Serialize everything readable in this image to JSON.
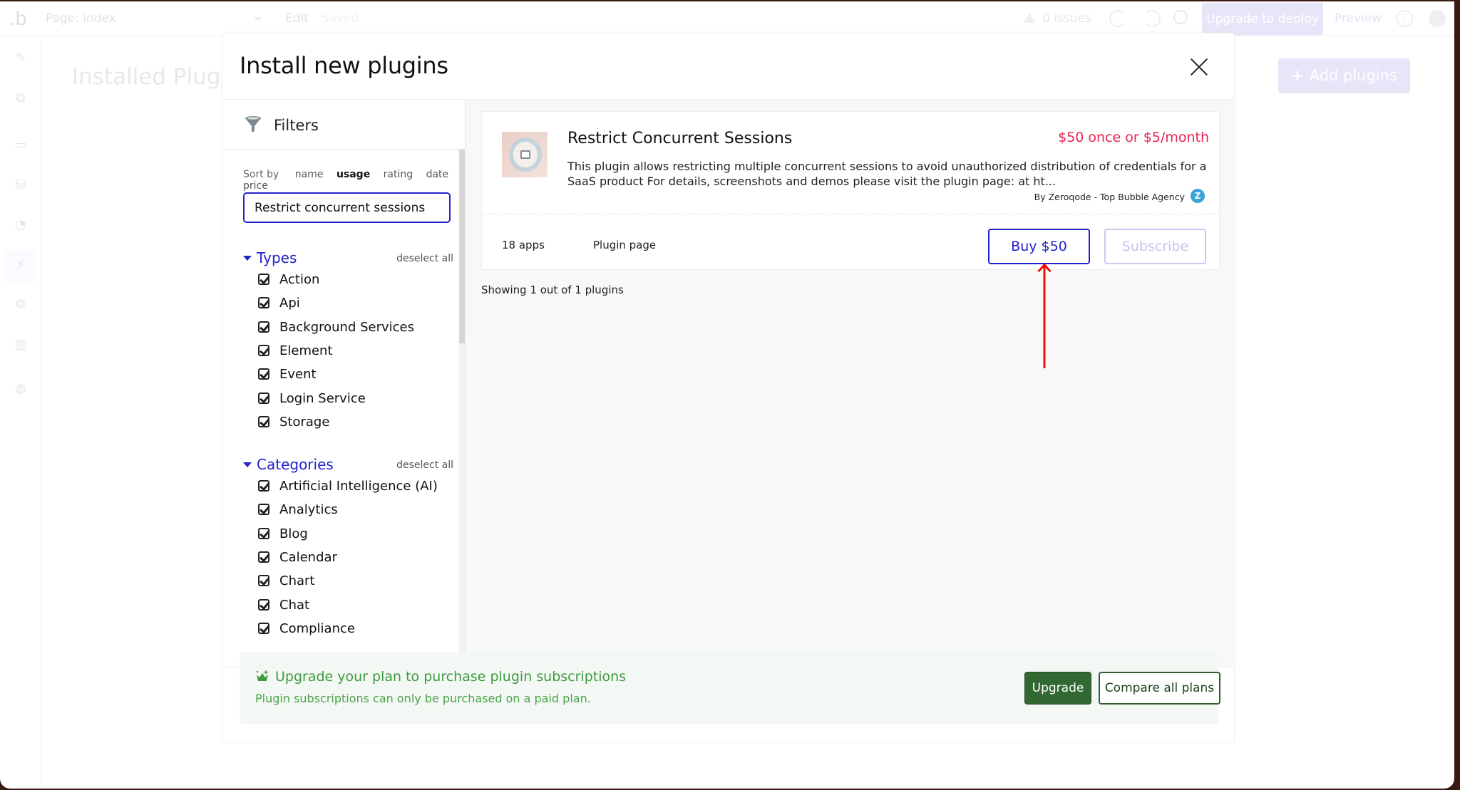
{
  "topbar": {
    "logo": ".b",
    "page_label": "Page: index",
    "edit_label": "Edit",
    "saved_label": "Saved",
    "issues_label": "0 issues",
    "upgrade_deploy_label": "Upgrade to deploy",
    "preview_label": "Preview",
    "help_glyph": "?"
  },
  "sidebar": {
    "items": [
      {
        "name": "design",
        "icon": "pencil-icon",
        "glyph": "✎"
      },
      {
        "name": "workflow",
        "icon": "workflow-icon",
        "glyph": "⧉"
      },
      {
        "name": "styles",
        "icon": "layout-icon",
        "glyph": "▭"
      },
      {
        "name": "data",
        "icon": "database-icon",
        "glyph": "⛁"
      },
      {
        "name": "appearance",
        "icon": "palette-icon",
        "glyph": "◔"
      },
      {
        "name": "plugins",
        "icon": "plug-icon",
        "glyph": "⚡"
      },
      {
        "name": "settings",
        "icon": "gear-icon",
        "glyph": "⚙"
      },
      {
        "name": "logs",
        "icon": "bar-chart-icon",
        "glyph": "▥"
      },
      {
        "name": "user",
        "icon": "user-badge-icon",
        "glyph": "◍"
      }
    ]
  },
  "background": {
    "title": "Installed Plugins",
    "add_plugins_label": "Add plugins",
    "add_plugins_icon": "+"
  },
  "modal": {
    "title": "Install new plugins",
    "filters": {
      "heading": "Filters",
      "sort_by_label": "Sort by",
      "sort_options": [
        "name",
        "usage",
        "rating",
        "date",
        "price"
      ],
      "sort_selected": "usage",
      "search_value": "Restrict concurrent sessions",
      "types": {
        "label": "Types",
        "deselect_label": "deselect all",
        "items": [
          "Action",
          "Api",
          "Background Services",
          "Element",
          "Event",
          "Login Service",
          "Storage"
        ]
      },
      "categories": {
        "label": "Categories",
        "deselect_label": "deselect all",
        "items": [
          "Artificial Intelligence (AI)",
          "Analytics",
          "Blog",
          "Calendar",
          "Chart",
          "Chat",
          "Compliance"
        ]
      }
    },
    "results": {
      "plugins": [
        {
          "title": "Restrict Concurrent Sessions",
          "price": "$50 once or $5/month",
          "description": "This plugin allows restricting multiple concurrent sessions to avoid unauthorized distribution of credentials for a SaaS product For details, screenshots and demos please visit the plugin page: at ht...",
          "author": "By Zeroqode - Top Bubble Agency",
          "author_badge": "Z",
          "apps_count": "18 apps",
          "plugin_page_label": "Plugin page",
          "buy_label": "Buy $50",
          "subscribe_label": "Subscribe"
        }
      ],
      "showing_text": "Showing 1 out of 1 plugins"
    },
    "footer": {
      "title": "Upgrade your plan to purchase plugin subscriptions",
      "subtitle": "Plugin subscriptions can only be purchased on a paid plan.",
      "upgrade_label": "Upgrade",
      "compare_label": "Compare all plans"
    }
  },
  "colors": {
    "accent": "#2222cc",
    "price": "#e8244f",
    "upgrade_green": "#326832",
    "banner_text": "#3e9a3e",
    "annotation_arrow": "#ee0000"
  }
}
